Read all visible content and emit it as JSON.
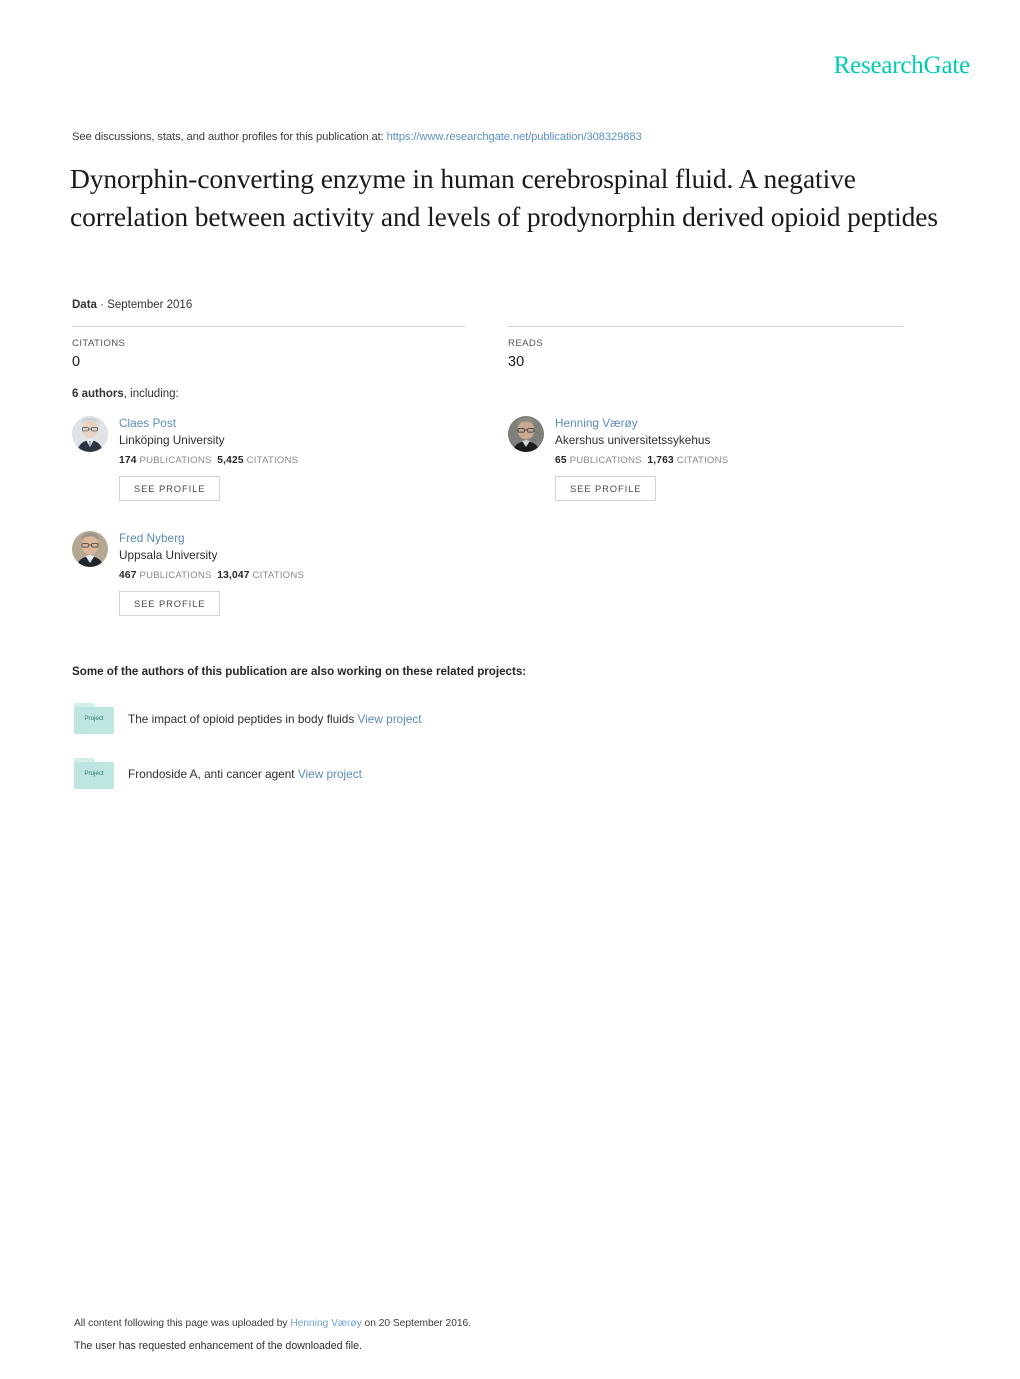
{
  "header": {
    "logo_text": "ResearchGate",
    "logo_color": "#00ccb2"
  },
  "discussion": {
    "prefix": "See discussions, stats, and author profiles for this publication at:",
    "url": "https://www.researchgate.net/publication/308329883",
    "link_color": "#5b8fc9"
  },
  "publication": {
    "title": "Dynorphin-converting enzyme in human cerebrospinal fluid. A negative correlation between activity and levels of prodynorphin derived opioid peptides",
    "type": "Data",
    "separator": "·",
    "date": "September 2016"
  },
  "stats": {
    "citations": {
      "label": "CITATIONS",
      "value": "0"
    },
    "reads": {
      "label": "READS",
      "value": "30"
    }
  },
  "authors_section": {
    "count_text": "6 authors",
    "suffix": ", including:",
    "see_profile_label": "SEE PROFILE",
    "publications_label": "PUBLICATIONS",
    "citations_label": "CITATIONS",
    "name_color": "#5b8cb8",
    "authors": [
      {
        "name": "Claes Post",
        "institution": "Linköping University",
        "publications": "174",
        "citations": "5,425"
      },
      {
        "name": "Henning Værøy",
        "institution": "Akershus universitetssykehus",
        "publications": "65",
        "citations": "1,763"
      },
      {
        "name": "Fred Nyberg",
        "institution": "Uppsala University",
        "publications": "467",
        "citations": "13,047"
      }
    ]
  },
  "projects_section": {
    "heading": "Some of the authors of this publication are also working on these related projects:",
    "folder_label": "Project",
    "folder_color": "#bfe5e0",
    "view_label": "View project",
    "projects": [
      {
        "title": "The impact of opioid peptides in body fluids"
      },
      {
        "title": "Frondoside A, anti cancer agent"
      }
    ]
  },
  "footer": {
    "upload_prefix": "All content following this page was uploaded by",
    "uploader": "Henning Værøy",
    "upload_suffix": "on 20 September 2016.",
    "note": "The user has requested enhancement of the downloaded file."
  }
}
